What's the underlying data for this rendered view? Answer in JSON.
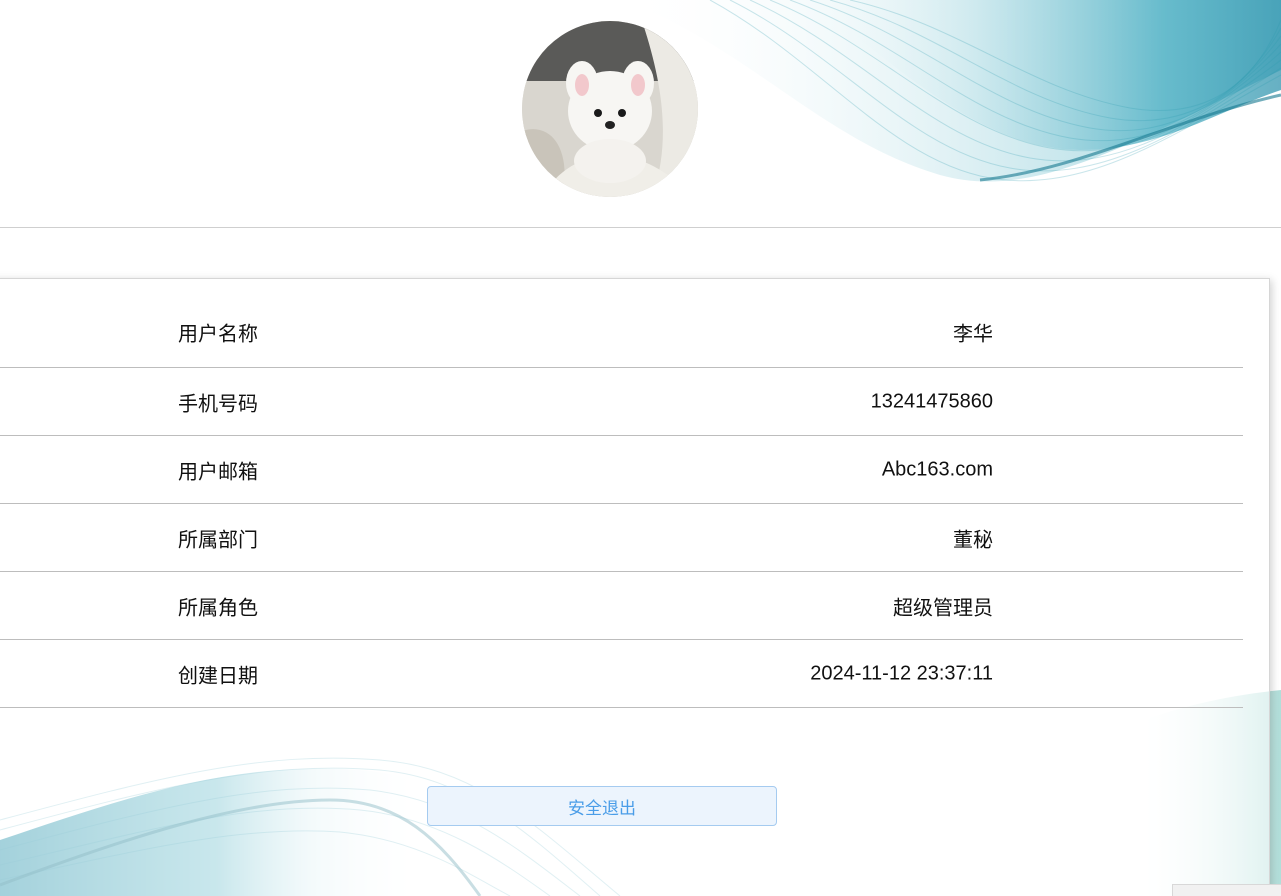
{
  "profile": {
    "avatar_subject": "white-puppy-photo",
    "fields": [
      {
        "label": "用户名称",
        "value": "李华"
      },
      {
        "label": "手机号码",
        "value": "13241475860"
      },
      {
        "label": "用户邮箱",
        "value": "Abc163.com"
      },
      {
        "label": "所属部门",
        "value": "董秘"
      },
      {
        "label": "所属角色",
        "value": "超级管理员"
      },
      {
        "label": "创建日期",
        "value": "2024-11-12 23:37:11"
      }
    ]
  },
  "actions": {
    "logout_label": "安全退出"
  },
  "theme": {
    "accent": "#4a9de8",
    "wave_color": "#2a9bb0",
    "divider": "#bdbdbd"
  }
}
